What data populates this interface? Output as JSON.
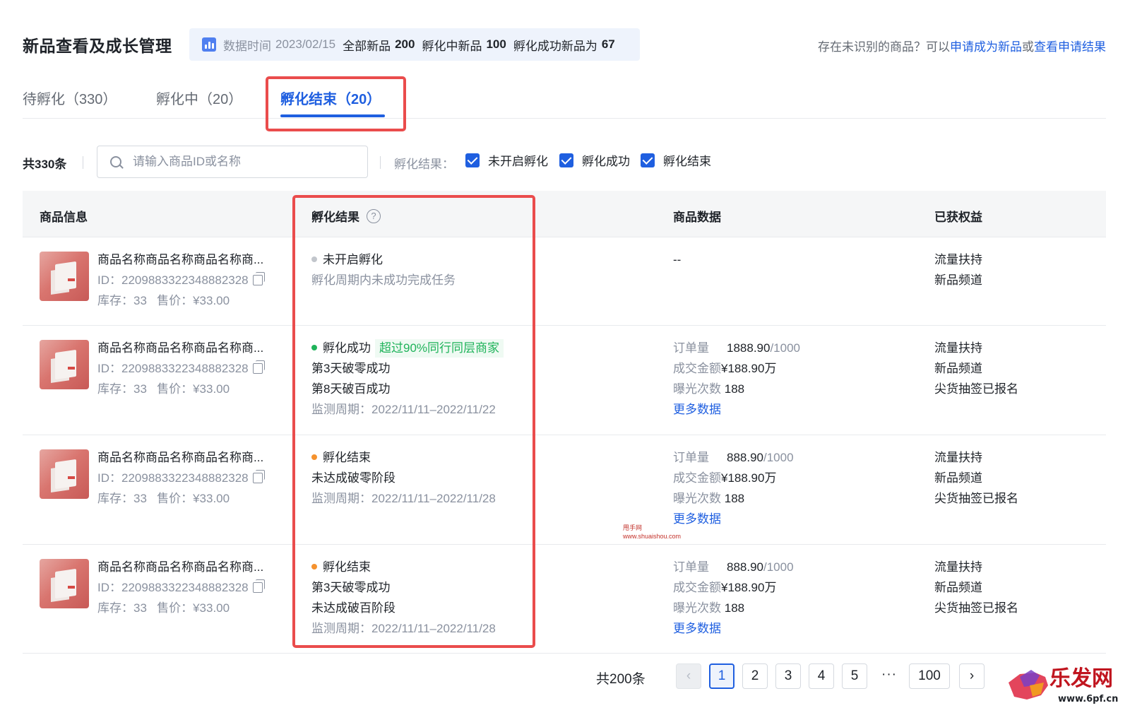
{
  "header": {
    "title": "新品查看及成长管理",
    "banner": {
      "time_label": "数据时间",
      "time_value": "2023/02/15",
      "all_label": "全部新品",
      "all_value": "200",
      "incubating_label": "孵化中新品",
      "incubating_value": "100",
      "success_label": "孵化成功新品为",
      "success_value": "67"
    },
    "notice": {
      "prefix": "存在未识别的商品？可以",
      "apply_link": "申请成为新品",
      "or_text": "或",
      "result_link": "查看申请结果"
    }
  },
  "tabs": [
    {
      "label": "待孵化（330）"
    },
    {
      "label": "孵化中（20）"
    },
    {
      "label": "孵化结束（20）",
      "active": true
    }
  ],
  "filter": {
    "total": "共330条",
    "search_placeholder": "请输入商品ID或名称",
    "result_label": "孵化结果：",
    "options": [
      {
        "label": "未开启孵化",
        "checked": true
      },
      {
        "label": "孵化成功",
        "checked": true
      },
      {
        "label": "孵化结束",
        "checked": true
      }
    ]
  },
  "table": {
    "columns": [
      "商品信息",
      "孵化结果",
      "商品数据",
      "已获权益"
    ],
    "help_glyph": "?",
    "metric_labels": {
      "orders": "订单量",
      "gmv": "成交金额",
      "exposure": "曝光次数"
    },
    "more_link": "更多数据",
    "rows": [
      {
        "name": "商品名称商品名称商品名称商...",
        "id": "ID：2209883322348882328",
        "stock": "库存：33",
        "price": "售价：¥33.00",
        "status": "未开启孵化",
        "status_color": "#c2c6cc",
        "badge": "",
        "lines": [],
        "note": "孵化周期内未成功完成任务",
        "data_empty": "--",
        "orders": "",
        "orders_target": "",
        "gmv": "",
        "exposure": "",
        "benefits": [
          "流量扶持",
          "新品频道"
        ]
      },
      {
        "name": "商品名称商品名称商品名称商...",
        "id": "ID：2209883322348882328",
        "stock": "库存：33",
        "price": "售价：¥33.00",
        "status": "孵化成功",
        "status_color": "#1fb35a",
        "badge": "超过90%同行同层商家",
        "lines": [
          "第3天破零成功",
          "第8天破百成功"
        ],
        "note": "监测周期：2022/11/11–2022/11/22",
        "data_empty": "",
        "orders": "1888.90",
        "orders_target": "/1000",
        "gmv": "¥188.90万",
        "exposure": "188",
        "benefits": [
          "流量扶持",
          "新品频道",
          "尖货抽签已报名"
        ]
      },
      {
        "name": "商品名称商品名称商品名称商...",
        "id": "ID：2209883322348882328",
        "stock": "库存：33",
        "price": "售价：¥33.00",
        "status": "孵化结束",
        "status_color": "#f5922e",
        "badge": "",
        "lines": [
          "未达成破零阶段"
        ],
        "note": "监测周期：2022/11/11–2022/11/28",
        "data_empty": "",
        "orders": "888.90",
        "orders_target": "/1000",
        "gmv": "¥188.90万",
        "exposure": "188",
        "benefits": [
          "流量扶持",
          "新品频道",
          "尖货抽签已报名"
        ]
      },
      {
        "name": "商品名称商品名称商品名称商...",
        "id": "ID：2209883322348882328",
        "stock": "库存：33",
        "price": "售价：¥33.00",
        "status": "孵化结束",
        "status_color": "#f5922e",
        "badge": "",
        "lines": [
          "第3天破零成功",
          "未达成破百阶段"
        ],
        "note": "监测周期：2022/11/11–2022/11/28",
        "data_empty": "",
        "orders": "888.90",
        "orders_target": "/1000",
        "gmv": "¥188.90万",
        "exposure": "188",
        "benefits": [
          "流量扶持",
          "新品频道",
          "尖货抽签已报名"
        ]
      }
    ]
  },
  "watermark": {
    "line1": "甩手网",
    "line2": "www.shuaishou.com"
  },
  "pagination": {
    "total": "共200条",
    "prev": "‹",
    "next": "›",
    "pages": [
      "1",
      "2",
      "3",
      "4",
      "5"
    ],
    "ellipsis": "···",
    "last": "100",
    "current": "1"
  },
  "corner_logo": {
    "text": "乐发网",
    "url": "www.6pf.cn"
  },
  "colors": {
    "accent": "#1f5fe0",
    "highlight_box": "#ea4c4c",
    "success": "#1fb35a",
    "warning": "#f5922e"
  }
}
